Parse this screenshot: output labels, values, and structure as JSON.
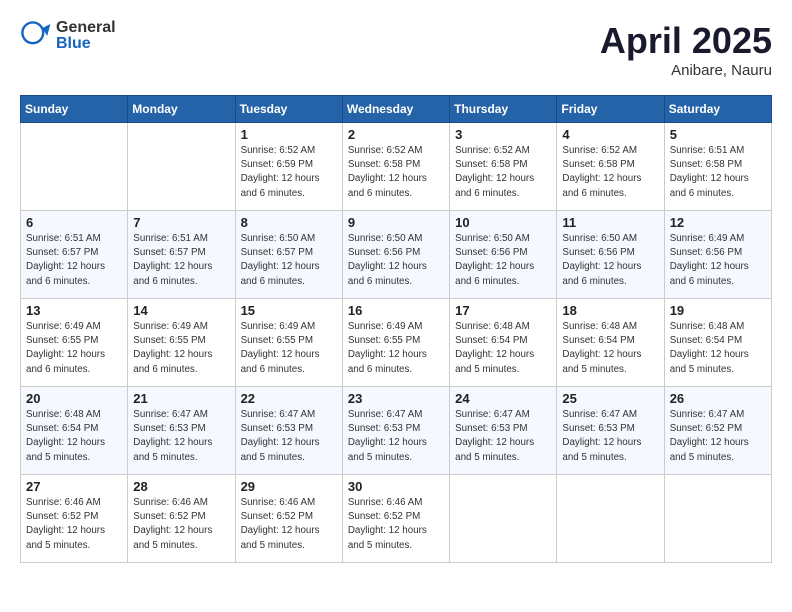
{
  "header": {
    "logo_general": "General",
    "logo_blue": "Blue",
    "month_title": "April 2025",
    "location": "Anibare, Nauru"
  },
  "days_of_week": [
    "Sunday",
    "Monday",
    "Tuesday",
    "Wednesday",
    "Thursday",
    "Friday",
    "Saturday"
  ],
  "weeks": [
    [
      {
        "day": "",
        "info": ""
      },
      {
        "day": "",
        "info": ""
      },
      {
        "day": "1",
        "sunrise": "6:52 AM",
        "sunset": "6:59 PM",
        "daylight": "12 hours and 6 minutes."
      },
      {
        "day": "2",
        "sunrise": "6:52 AM",
        "sunset": "6:58 PM",
        "daylight": "12 hours and 6 minutes."
      },
      {
        "day": "3",
        "sunrise": "6:52 AM",
        "sunset": "6:58 PM",
        "daylight": "12 hours and 6 minutes."
      },
      {
        "day": "4",
        "sunrise": "6:52 AM",
        "sunset": "6:58 PM",
        "daylight": "12 hours and 6 minutes."
      },
      {
        "day": "5",
        "sunrise": "6:51 AM",
        "sunset": "6:58 PM",
        "daylight": "12 hours and 6 minutes."
      }
    ],
    [
      {
        "day": "6",
        "sunrise": "6:51 AM",
        "sunset": "6:57 PM",
        "daylight": "12 hours and 6 minutes."
      },
      {
        "day": "7",
        "sunrise": "6:51 AM",
        "sunset": "6:57 PM",
        "daylight": "12 hours and 6 minutes."
      },
      {
        "day": "8",
        "sunrise": "6:50 AM",
        "sunset": "6:57 PM",
        "daylight": "12 hours and 6 minutes."
      },
      {
        "day": "9",
        "sunrise": "6:50 AM",
        "sunset": "6:56 PM",
        "daylight": "12 hours and 6 minutes."
      },
      {
        "day": "10",
        "sunrise": "6:50 AM",
        "sunset": "6:56 PM",
        "daylight": "12 hours and 6 minutes."
      },
      {
        "day": "11",
        "sunrise": "6:50 AM",
        "sunset": "6:56 PM",
        "daylight": "12 hours and 6 minutes."
      },
      {
        "day": "12",
        "sunrise": "6:49 AM",
        "sunset": "6:56 PM",
        "daylight": "12 hours and 6 minutes."
      }
    ],
    [
      {
        "day": "13",
        "sunrise": "6:49 AM",
        "sunset": "6:55 PM",
        "daylight": "12 hours and 6 minutes."
      },
      {
        "day": "14",
        "sunrise": "6:49 AM",
        "sunset": "6:55 PM",
        "daylight": "12 hours and 6 minutes."
      },
      {
        "day": "15",
        "sunrise": "6:49 AM",
        "sunset": "6:55 PM",
        "daylight": "12 hours and 6 minutes."
      },
      {
        "day": "16",
        "sunrise": "6:49 AM",
        "sunset": "6:55 PM",
        "daylight": "12 hours and 6 minutes."
      },
      {
        "day": "17",
        "sunrise": "6:48 AM",
        "sunset": "6:54 PM",
        "daylight": "12 hours and 5 minutes."
      },
      {
        "day": "18",
        "sunrise": "6:48 AM",
        "sunset": "6:54 PM",
        "daylight": "12 hours and 5 minutes."
      },
      {
        "day": "19",
        "sunrise": "6:48 AM",
        "sunset": "6:54 PM",
        "daylight": "12 hours and 5 minutes."
      }
    ],
    [
      {
        "day": "20",
        "sunrise": "6:48 AM",
        "sunset": "6:54 PM",
        "daylight": "12 hours and 5 minutes."
      },
      {
        "day": "21",
        "sunrise": "6:47 AM",
        "sunset": "6:53 PM",
        "daylight": "12 hours and 5 minutes."
      },
      {
        "day": "22",
        "sunrise": "6:47 AM",
        "sunset": "6:53 PM",
        "daylight": "12 hours and 5 minutes."
      },
      {
        "day": "23",
        "sunrise": "6:47 AM",
        "sunset": "6:53 PM",
        "daylight": "12 hours and 5 minutes."
      },
      {
        "day": "24",
        "sunrise": "6:47 AM",
        "sunset": "6:53 PM",
        "daylight": "12 hours and 5 minutes."
      },
      {
        "day": "25",
        "sunrise": "6:47 AM",
        "sunset": "6:53 PM",
        "daylight": "12 hours and 5 minutes."
      },
      {
        "day": "26",
        "sunrise": "6:47 AM",
        "sunset": "6:52 PM",
        "daylight": "12 hours and 5 minutes."
      }
    ],
    [
      {
        "day": "27",
        "sunrise": "6:46 AM",
        "sunset": "6:52 PM",
        "daylight": "12 hours and 5 minutes."
      },
      {
        "day": "28",
        "sunrise": "6:46 AM",
        "sunset": "6:52 PM",
        "daylight": "12 hours and 5 minutes."
      },
      {
        "day": "29",
        "sunrise": "6:46 AM",
        "sunset": "6:52 PM",
        "daylight": "12 hours and 5 minutes."
      },
      {
        "day": "30",
        "sunrise": "6:46 AM",
        "sunset": "6:52 PM",
        "daylight": "12 hours and 5 minutes."
      },
      {
        "day": "",
        "info": ""
      },
      {
        "day": "",
        "info": ""
      },
      {
        "day": "",
        "info": ""
      }
    ]
  ]
}
